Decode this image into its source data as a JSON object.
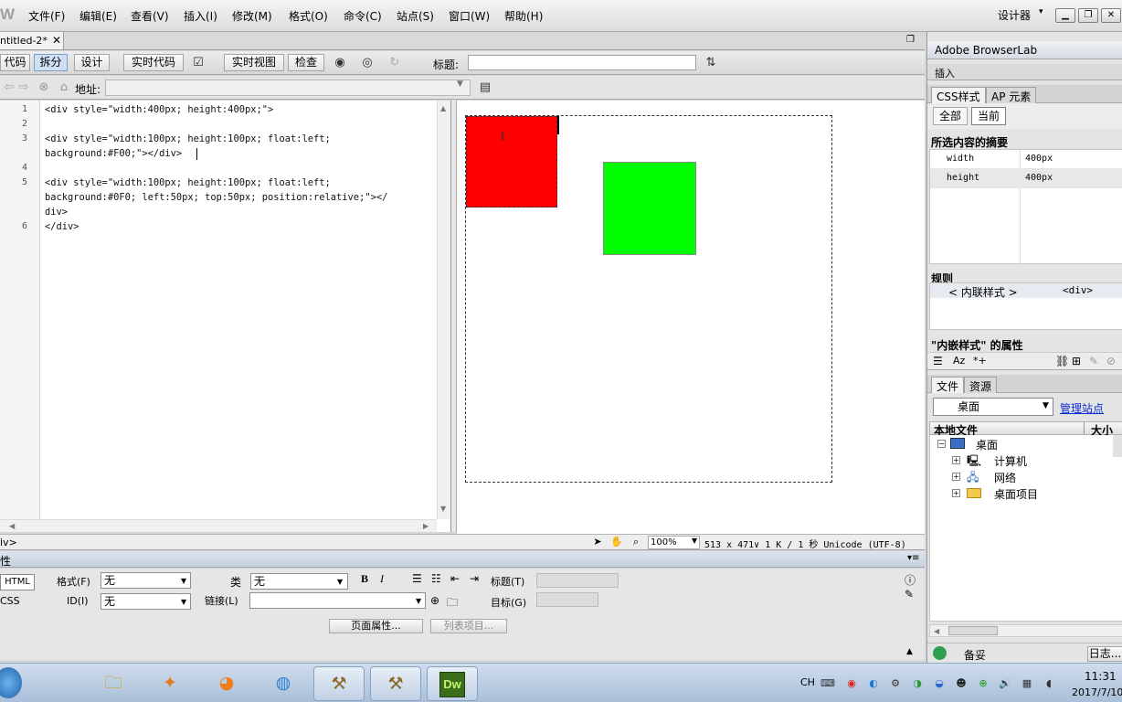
{
  "app": {
    "logo_text": "W"
  },
  "menu": {
    "items": [
      "文件(F)",
      "编辑(E)",
      "查看(V)",
      "插入(I)",
      "修改(M)",
      "格式(O)",
      "命令(C)",
      "站点(S)",
      "窗口(W)",
      "帮助(H)"
    ],
    "workspace": "设计器",
    "workspace_caret": "▾"
  },
  "window_controls": {
    "minimize": "▁",
    "restore": "❐",
    "close": "✕"
  },
  "document": {
    "tab_label": "ntitled-2*",
    "tab_close": "✕"
  },
  "doc_toolbar": {
    "code_btn": "代码",
    "split_btn": "拆分",
    "design_btn": "设计",
    "live_code_btn": "实时代码",
    "live_view_btn": "实时视图",
    "inspect_btn": "检查",
    "title_label": "标题:",
    "title_value": ""
  },
  "address_bar": {
    "label": "地址:",
    "value": ""
  },
  "code": {
    "line_numbers": [
      "1",
      "2",
      "3",
      "4",
      "5",
      "6"
    ],
    "lines": [
      "<div style=\"width:400px; height:400px;\">",
      "",
      "<div style=\"width:100px; height:100px; float:left;",
      "background:#F00;\"></div>",
      "",
      "<div style=\"width:100px; height:100px; float:left;",
      "background:#0F0; left:50px; top:50px; position:relative;\"></",
      "div>",
      "</div>"
    ]
  },
  "design_view": {
    "red_color": "#ff0000",
    "green_color": "#00ff00",
    "cursor_glyph": "I"
  },
  "status_bar": {
    "tag": "iv>",
    "zoom": "100%",
    "info": "513 x 471∨ 1 K / 1 秒 Unicode (UTF-8)"
  },
  "properties": {
    "header": "性",
    "html_btn": "HTML",
    "css_btn": "CSS",
    "format_label": "格式(F)",
    "format_value": "无",
    "id_label": "ID(I)",
    "id_value": "无",
    "class_label": "类",
    "class_value": "无",
    "link_label": "链接(L)",
    "link_value": "",
    "title_label": "标题(T)",
    "target_label": "目标(G)",
    "page_props_btn": "页面属性...",
    "list_item_btn": "列表项目...",
    "bold": "B",
    "italic": "I"
  },
  "right_panel": {
    "browserlab": "Adobe BrowserLab",
    "insert": "插入",
    "css_tab": "CSS样式",
    "ap_tab": "AP 元素",
    "all_btn": "全部",
    "current_btn": "当前",
    "summary_title": "所选内容的摘要",
    "props": [
      {
        "key": "width",
        "value": "400px"
      },
      {
        "key": "height",
        "value": "400px"
      }
    ],
    "rules_title": "规则",
    "rule_name": "< 内联样式 >",
    "rule_tag": "<div>",
    "attr_title": "\"内嵌样式\" 的属性",
    "files_tab": "文件",
    "assets_tab": "资源",
    "site_value": "桌面",
    "manage_sites": "管理站点",
    "local_files": "本地文件",
    "size_col": "大小",
    "tree": [
      {
        "label": "桌面",
        "level": 0
      },
      {
        "label": "计算机",
        "level": 1
      },
      {
        "label": "网络",
        "level": 1
      },
      {
        "label": "桌面项目",
        "level": 1
      }
    ],
    "footer_label": "备妥",
    "log_btn": "日志..."
  },
  "taskbar": {
    "lang": "CH",
    "time": "11:31",
    "date": "2017/7/10"
  }
}
